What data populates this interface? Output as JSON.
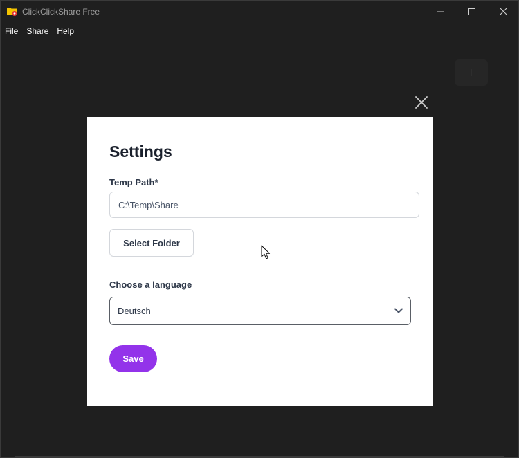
{
  "window": {
    "title": "ClickClickShare Free",
    "controls": {
      "minimize": "minimize-icon",
      "maximize": "maximize-icon",
      "close": "close-icon"
    }
  },
  "menu": {
    "items": [
      {
        "label": "File"
      },
      {
        "label": "Share"
      },
      {
        "label": "Help"
      }
    ]
  },
  "modal": {
    "title": "Settings",
    "temp_path": {
      "label": "Temp Path*",
      "value": "C:\\Temp\\Share"
    },
    "select_folder_label": "Select Folder",
    "language": {
      "label": "Choose a language",
      "selected": "Deutsch"
    },
    "save_label": "Save",
    "close_icon": "close-icon"
  },
  "colors": {
    "background": "#1f1f1f",
    "modal": "#ffffff",
    "accent": "#9333ea",
    "heading": "#1a202c",
    "text": "#2d3748",
    "border": "#d4d7dc"
  }
}
